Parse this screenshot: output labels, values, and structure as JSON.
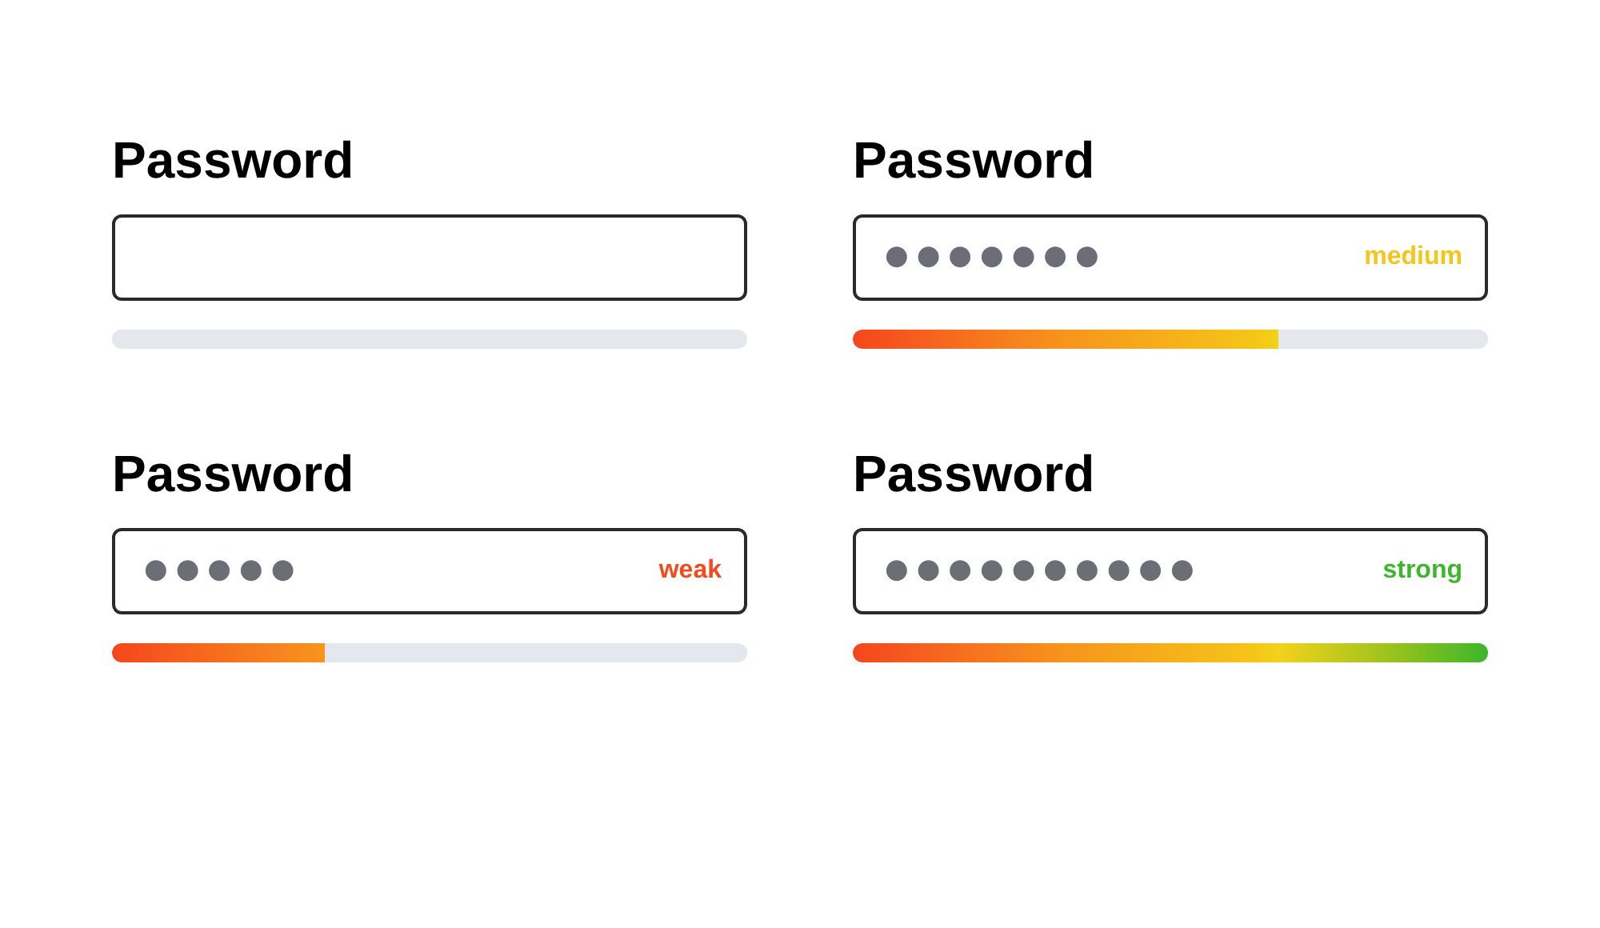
{
  "fields": [
    {
      "label": "Password"
    },
    {
      "label": "Password",
      "value": "●●●●●●●",
      "strength": "medium",
      "kind": "medium",
      "level": 0.67
    },
    {
      "label": "Password",
      "value": "●●●●●",
      "strength": "weak",
      "kind": "weak",
      "level": 0.335
    },
    {
      "label": "Password",
      "value": "●●●●●●●●●●",
      "strength": "strong",
      "kind": "strong",
      "level": 1
    }
  ]
}
